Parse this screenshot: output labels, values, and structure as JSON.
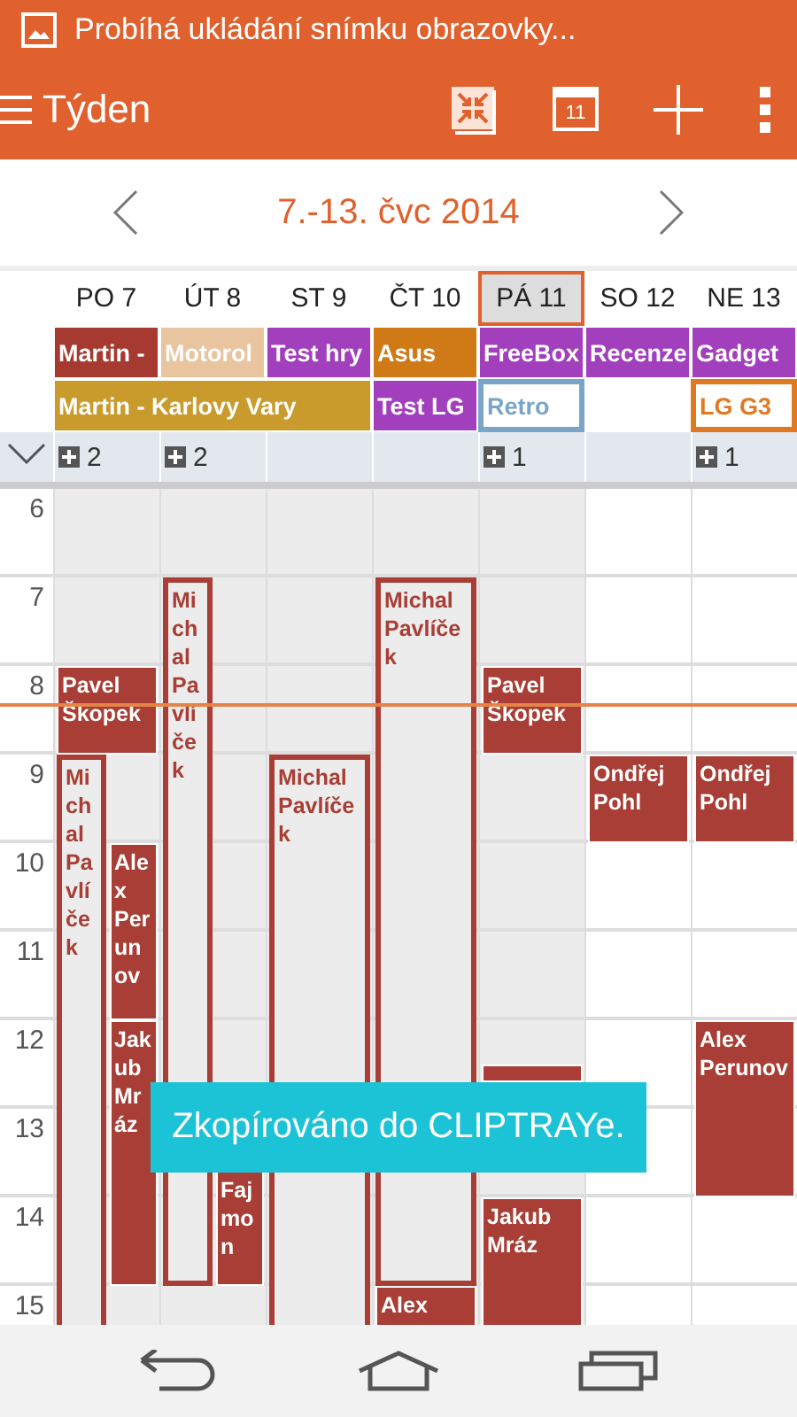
{
  "status_bar": {
    "notification": "Probíhá ukládání snímku obrazovky..."
  },
  "action_bar": {
    "title": "Týden",
    "today_badge": "11"
  },
  "range": {
    "label": "7.-13. čvc 2014"
  },
  "all_day_rows": [
    [
      {
        "kind": "filled",
        "title": "Martin -",
        "color": "#a63a31"
      },
      {
        "kind": "filled",
        "title": "Motorol",
        "color": "#e8c49f"
      },
      {
        "kind": "filled",
        "title": "Test hry",
        "color": "#a23fbd"
      },
      {
        "kind": "filled",
        "title": "Asus",
        "color": "#cf7a17"
      },
      {
        "kind": "filled",
        "title": "FreeBox",
        "color": "#a23fbd"
      },
      {
        "kind": "filled",
        "title": "Recenze",
        "color": "#a23fbd"
      },
      {
        "kind": "filled",
        "title": "Gadget",
        "color": "#a23fbd"
      }
    ],
    [
      {
        "kind": "filled",
        "title": "Martin - Karlovy Vary",
        "color": "#c99b2c"
      },
      {
        "kind": "continued"
      },
      {
        "kind": "continued"
      },
      {
        "kind": "filled",
        "title": "Test LG",
        "color": "#a23fbd"
      },
      {
        "kind": "outlined",
        "title": "Retro",
        "color": "#7ba5c6"
      },
      {
        "kind": "empty"
      },
      {
        "kind": "outlined",
        "title": "LG G3",
        "color": "#e07a22"
      }
    ]
  ],
  "hours": [
    "6",
    "7",
    "8",
    "9",
    "10",
    "11",
    "12",
    "13",
    "14",
    "15"
  ],
  "days": [
    {
      "label": "PO 7",
      "selected": false,
      "past": true,
      "more": "2",
      "events": [
        {
          "kind": "filled",
          "title": "Pavel Škopek"
        },
        {
          "kind": "outlined",
          "title": "Michal Pavlíček"
        },
        {
          "kind": "filled",
          "title": "Alex Perunov"
        },
        {
          "kind": "filled",
          "title": "Jakub Mráz"
        }
      ]
    },
    {
      "label": "ÚT 8",
      "selected": false,
      "past": true,
      "more": "2",
      "events": [
        {
          "kind": "outlined",
          "title": "Michal Pavlíček"
        },
        {
          "kind": "filled",
          "title": "Fajmon"
        }
      ]
    },
    {
      "label": "ST 9",
      "selected": false,
      "past": true,
      "events": [
        {
          "kind": "outlined",
          "title": "Michal Pavlíček"
        }
      ]
    },
    {
      "label": "ČT 10",
      "selected": false,
      "past": true,
      "events": [
        {
          "kind": "outlined",
          "title": "Michal Pavlíček"
        },
        {
          "kind": "filled",
          "title": "Alex"
        }
      ]
    },
    {
      "label": "PÁ 11",
      "selected": true,
      "past": true,
      "more": "1",
      "events": [
        {
          "kind": "filled",
          "title": "Pavel Škopek"
        },
        {
          "kind": "filled"
        },
        {
          "kind": "filled",
          "title": "Jakub Mráz"
        }
      ]
    },
    {
      "label": "SO 12",
      "selected": false,
      "past": false,
      "events": [
        {
          "kind": "filled",
          "title": "Ondřej Pohl"
        }
      ]
    },
    {
      "label": "NE 13",
      "selected": false,
      "past": false,
      "more": "1",
      "events": [
        {
          "kind": "filled",
          "title": "Ondřej Pohl"
        },
        {
          "kind": "filled",
          "title": "Alex Perunov"
        }
      ]
    }
  ],
  "toast": {
    "text": "Zkopírováno do CLIPTRAYe."
  }
}
